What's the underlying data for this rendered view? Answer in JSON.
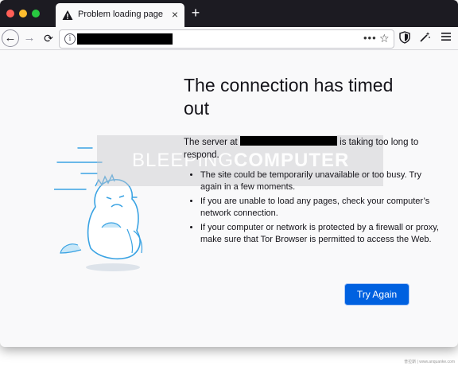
{
  "tab": {
    "title": "Problem loading page",
    "new_tab": "+",
    "close": "×"
  },
  "error": {
    "heading": "The connection has timed out",
    "server_prefix": "The server at",
    "server_suffix": "is taking too long to respond.",
    "reasons": [
      "The site could be temporarily unavailable or too busy. Try again in a few moments.",
      "If you are unable to load any pages, check your computer’s network connection.",
      "If your computer or network is protected by a firewall or proxy, make sure that Tor Browser is permitted to access the Web."
    ],
    "button_label": "Try Again"
  },
  "watermark": {
    "part1": "BLEEPING",
    "part2": "COMPUTER"
  },
  "credit": "普拉斯 | www.anquanke.com",
  "icons": {
    "back": "back-arrow-icon",
    "forward": "forward-arrow-icon",
    "reload": "reload-icon",
    "info": "info-icon",
    "page_actions": "dots-icon",
    "bookmark": "star-icon",
    "security": "shield-icon",
    "customize": "magic-wand-icon",
    "menu": "hamburger-menu-icon",
    "warning": "warning-triangle-icon"
  },
  "colors": {
    "tab_bar": "#1c1b22",
    "button": "#0061e0",
    "page_bg": "#f9f9fa",
    "traffic_close": "#ff5f57",
    "traffic_min": "#febc2e",
    "traffic_max": "#28c840"
  }
}
